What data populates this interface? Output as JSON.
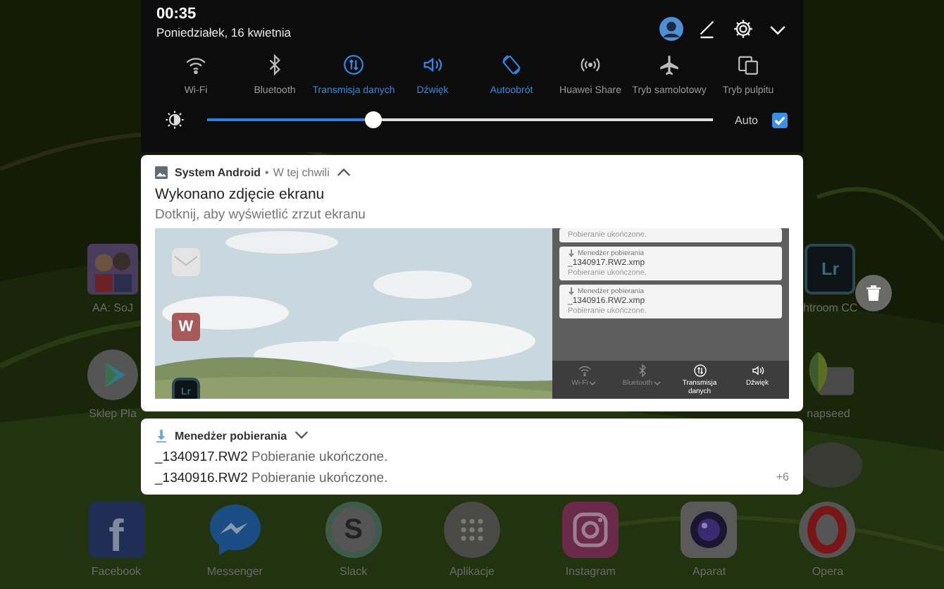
{
  "status": {
    "time": "00:35",
    "date": "Poniedziałek, 16 kwietnia"
  },
  "tiles": [
    {
      "label": "Wi-Fi",
      "kind": "wifi",
      "on": false
    },
    {
      "label": "Bluetooth",
      "kind": "bluetooth",
      "on": false
    },
    {
      "label": "Transmisja danych",
      "kind": "data",
      "on": true
    },
    {
      "label": "Dźwięk",
      "kind": "sound",
      "on": true
    },
    {
      "label": "Autoobrót",
      "kind": "rotate",
      "on": true
    },
    {
      "label": "Huawei Share",
      "kind": "share",
      "on": false
    },
    {
      "label": "Tryb samolotowy",
      "kind": "plane",
      "on": false
    },
    {
      "label": "Tryb pulpitu",
      "kind": "desktop",
      "on": false
    }
  ],
  "brightness": {
    "level": 0.33,
    "auto_label": "Auto",
    "auto_checked": true
  },
  "screenshot_notification": {
    "app": "System Android",
    "separator": "•",
    "time": "W tej chwili",
    "expanded": true,
    "title": "Wykonano zdjęcie ekranu",
    "text": "Dotknij, aby wyświetlić zrzut ekranu",
    "preview": {
      "apps": [
        {
          "kind": "mail"
        },
        {
          "kind": "doc",
          "glyph": "W"
        },
        {
          "kind": "lr",
          "glyph": "Lr"
        }
      ],
      "downloads": [
        {
          "status": "Pobieranie ukończone."
        },
        {
          "source": "Menedżer pobierania",
          "file": "_1340917.RW2.xmp",
          "status": "Pobieranie ukończone."
        },
        {
          "source": "Menedżer pobierania",
          "file": "_1340916.RW2.xmp",
          "status": "Pobieranie ukończone."
        }
      ],
      "tiles": [
        {
          "label": "Wi-Fi",
          "kind": "wifi",
          "on": false,
          "menu": true
        },
        {
          "label": "Bluetooth",
          "kind": "bluetooth",
          "on": false,
          "menu": true
        },
        {
          "label": "Transmisja danych",
          "kind": "data",
          "on": true,
          "menu": false
        },
        {
          "label": "Dźwięk",
          "kind": "sound",
          "on": true,
          "menu": false
        }
      ]
    }
  },
  "download_notification": {
    "app": "Menedżer pobierania",
    "expanded": false,
    "items": [
      {
        "file": "_1340917.RW2",
        "status": "Pobieranie ukończone."
      },
      {
        "file": "_1340916.RW2",
        "status": "Pobieranie ukończone."
      }
    ],
    "more": "+6"
  },
  "home_apps": [
    {
      "label": "AA: SoJ",
      "kind": "game"
    },
    {
      "label": "Sklep Pla",
      "kind": "play"
    },
    {
      "label": "htroom CC",
      "kind": "lr",
      "glyph": "Lr"
    },
    {
      "label": "napseed",
      "kind": "snapseed"
    }
  ],
  "dock": [
    {
      "label": "Facebook",
      "kind": "facebook",
      "glyph": "f"
    },
    {
      "label": "Messenger",
      "kind": "messenger"
    },
    {
      "label": "Slack",
      "kind": "slack",
      "glyph": "S"
    },
    {
      "label": "Aplikacje",
      "kind": "apps"
    },
    {
      "label": "Instagram",
      "kind": "instagram"
    },
    {
      "label": "Aparat",
      "kind": "camera"
    },
    {
      "label": "Opera",
      "kind": "opera"
    }
  ]
}
